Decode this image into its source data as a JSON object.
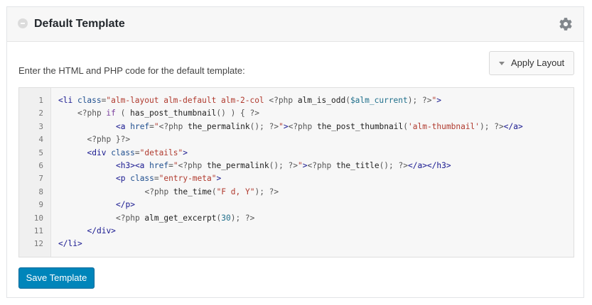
{
  "panel": {
    "title": "Default Template"
  },
  "instruction": "Enter the HTML and PHP code for the default template:",
  "apply_button": {
    "label": "Apply Layout"
  },
  "save_button": {
    "label": "Save Template"
  },
  "editor": {
    "lines": [
      {
        "number": "1",
        "indent": 0,
        "tokens": [
          {
            "t": "tag",
            "v": "<li "
          },
          {
            "t": "attr",
            "v": "class"
          },
          {
            "t": "php",
            "v": "="
          },
          {
            "t": "str",
            "v": "\"alm-layout alm-default alm-2-col "
          },
          {
            "t": "php",
            "v": "<?php "
          },
          {
            "t": "fn",
            "v": "alm_is_odd"
          },
          {
            "t": "php",
            "v": "("
          },
          {
            "t": "var",
            "v": "$alm_current"
          },
          {
            "t": "php",
            "v": "); ?>"
          },
          {
            "t": "str",
            "v": "\""
          },
          {
            "t": "tag",
            "v": ">"
          }
        ]
      },
      {
        "number": "2",
        "indent": 4,
        "tokens": [
          {
            "t": "php",
            "v": "<?php "
          },
          {
            "t": "kw",
            "v": "if"
          },
          {
            "t": "php",
            "v": " ( "
          },
          {
            "t": "fn",
            "v": "has_post_thumbnail"
          },
          {
            "t": "php",
            "v": "() ) { ?>"
          }
        ]
      },
      {
        "number": "3",
        "indent": 12,
        "tokens": [
          {
            "t": "tag",
            "v": "<a "
          },
          {
            "t": "attr",
            "v": "href"
          },
          {
            "t": "php",
            "v": "="
          },
          {
            "t": "str",
            "v": "\""
          },
          {
            "t": "php",
            "v": "<?php "
          },
          {
            "t": "fn",
            "v": "the_permalink"
          },
          {
            "t": "php",
            "v": "(); ?>"
          },
          {
            "t": "str",
            "v": "\""
          },
          {
            "t": "tag",
            "v": ">"
          },
          {
            "t": "php",
            "v": "<?php "
          },
          {
            "t": "fn",
            "v": "the_post_thumbnail"
          },
          {
            "t": "php",
            "v": "("
          },
          {
            "t": "str",
            "v": "'alm-thumbnail'"
          },
          {
            "t": "php",
            "v": "); ?>"
          },
          {
            "t": "tag",
            "v": "</a>"
          }
        ]
      },
      {
        "number": "4",
        "indent": 6,
        "tokens": [
          {
            "t": "php",
            "v": "<?php }?>"
          }
        ]
      },
      {
        "number": "5",
        "indent": 6,
        "tokens": [
          {
            "t": "tag",
            "v": "<div "
          },
          {
            "t": "attr",
            "v": "class"
          },
          {
            "t": "php",
            "v": "="
          },
          {
            "t": "str",
            "v": "\"details\""
          },
          {
            "t": "tag",
            "v": ">"
          }
        ]
      },
      {
        "number": "6",
        "indent": 12,
        "tokens": [
          {
            "t": "tag",
            "v": "<h3><a "
          },
          {
            "t": "attr",
            "v": "href"
          },
          {
            "t": "php",
            "v": "="
          },
          {
            "t": "str",
            "v": "\""
          },
          {
            "t": "php",
            "v": "<?php "
          },
          {
            "t": "fn",
            "v": "the_permalink"
          },
          {
            "t": "php",
            "v": "(); ?>"
          },
          {
            "t": "str",
            "v": "\""
          },
          {
            "t": "tag",
            "v": ">"
          },
          {
            "t": "php",
            "v": "<?php "
          },
          {
            "t": "fn",
            "v": "the_title"
          },
          {
            "t": "php",
            "v": "(); ?>"
          },
          {
            "t": "tag",
            "v": "</a></h3>"
          }
        ]
      },
      {
        "number": "7",
        "indent": 12,
        "tokens": [
          {
            "t": "tag",
            "v": "<p "
          },
          {
            "t": "attr",
            "v": "class"
          },
          {
            "t": "php",
            "v": "="
          },
          {
            "t": "str",
            "v": "\"entry-meta\""
          },
          {
            "t": "tag",
            "v": ">"
          }
        ]
      },
      {
        "number": "8",
        "indent": 18,
        "tokens": [
          {
            "t": "php",
            "v": "<?php "
          },
          {
            "t": "fn",
            "v": "the_time"
          },
          {
            "t": "php",
            "v": "("
          },
          {
            "t": "str",
            "v": "\"F d, Y\""
          },
          {
            "t": "php",
            "v": "); ?>"
          }
        ]
      },
      {
        "number": "9",
        "indent": 12,
        "tokens": [
          {
            "t": "tag",
            "v": "</p>"
          }
        ]
      },
      {
        "number": "10",
        "indent": 12,
        "tokens": [
          {
            "t": "php",
            "v": "<?php "
          },
          {
            "t": "fn",
            "v": "alm_get_excerpt"
          },
          {
            "t": "php",
            "v": "("
          },
          {
            "t": "num",
            "v": "30"
          },
          {
            "t": "php",
            "v": "); ?>"
          }
        ]
      },
      {
        "number": "11",
        "indent": 6,
        "tokens": [
          {
            "t": "tag",
            "v": "</div>"
          }
        ]
      },
      {
        "number": "12",
        "indent": 0,
        "tokens": [
          {
            "t": "tag",
            "v": "</li>"
          }
        ]
      }
    ]
  },
  "colors": {
    "primary_button": "#0085ba",
    "header_background": "#f7f7f7",
    "editor_background": "#f7f7f7"
  }
}
